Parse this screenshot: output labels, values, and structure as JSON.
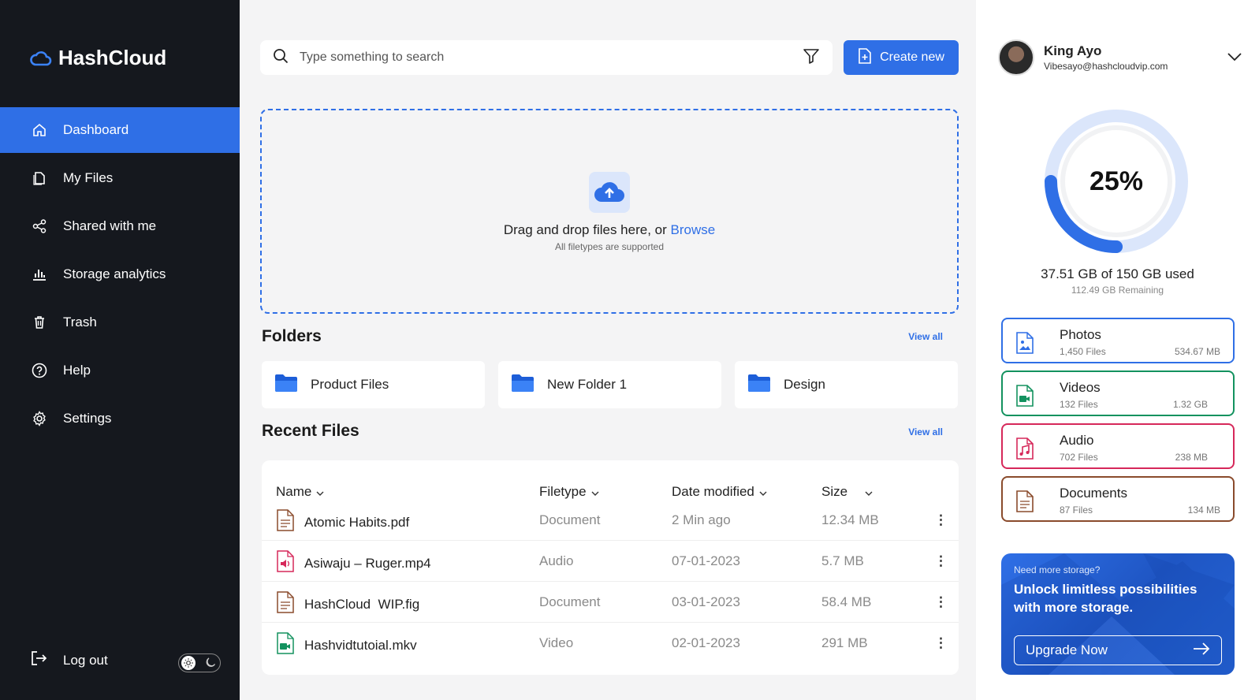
{
  "app": {
    "name": "HashCloud"
  },
  "sidebar": {
    "items": [
      {
        "label": "Dashboard",
        "icon": "home-icon",
        "active": true
      },
      {
        "label": "My Files",
        "icon": "files-icon"
      },
      {
        "label": "Shared with me",
        "icon": "share-icon"
      },
      {
        "label": "Storage analytics",
        "icon": "chart-icon"
      },
      {
        "label": "Trash",
        "icon": "trash-icon"
      },
      {
        "label": "Help",
        "icon": "help-icon"
      },
      {
        "label": "Settings",
        "icon": "gear-icon"
      }
    ],
    "logout_label": "Log out",
    "theme": "light"
  },
  "search": {
    "placeholder": "Type something to search"
  },
  "create_label": "Create new",
  "upload": {
    "text": "Drag and drop files here, or ",
    "browse": "Browse",
    "sub": "All filetypes are supported"
  },
  "folders": {
    "title": "Folders",
    "view_all": "View all",
    "items": [
      "Product Files",
      "New Folder 1",
      "Design"
    ]
  },
  "recent": {
    "title": "Recent Files",
    "view_all": "View all",
    "columns": [
      "Name",
      "Filetype",
      "Date modified",
      "Size"
    ],
    "rows": [
      {
        "name": "Atomic Habits.pdf",
        "type": "Document",
        "date": "2 Min ago",
        "size": "12.34 MB",
        "icon": "document-icon"
      },
      {
        "name": "Asiwaju – Ruger.mp4",
        "type": "Audio",
        "date": "07-01-2023",
        "size": "5.7 MB",
        "icon": "audio-file-icon"
      },
      {
        "name": "HashCloud  WIP.fig",
        "type": "Document",
        "date": "03-01-2023",
        "size": "58.4 MB",
        "icon": "document-icon"
      },
      {
        "name": "Hashvidtutoial.mkv",
        "type": "Video",
        "date": "02-01-2023",
        "size": "291 MB",
        "icon": "video-file-icon"
      }
    ]
  },
  "profile": {
    "name": "King Ayo",
    "email": "Vibesayo@hashcloudvip.com"
  },
  "storage": {
    "percent": 25,
    "percent_label": "25%",
    "used_label": "37.51 GB of 150 GB used",
    "remaining_label": "112.49 GB Remaining"
  },
  "categories": [
    {
      "name": "Photos",
      "files": "1,450 Files",
      "size": "534.67 MB",
      "color": "#2f6fe6",
      "icon": "image-icon"
    },
    {
      "name": "Videos",
      "files": "132 Files",
      "size": "1.32 GB",
      "color": "#13925f",
      "icon": "video-icon"
    },
    {
      "name": "Audio",
      "files": "702 Files",
      "size": "238 MB",
      "color": "#d6285a",
      "icon": "music-icon"
    },
    {
      "name": "Documents",
      "files": "87 Files",
      "size": "134 MB",
      "color": "#8a4b2c",
      "icon": "document-icon"
    }
  ],
  "promo": {
    "small": "Need more storage?",
    "title": "Unlock limitless possibilities with more storage.",
    "button": "Upgrade Now"
  },
  "colors": {
    "accent": "#2f6fe6",
    "sidebar_bg": "#15181e"
  }
}
